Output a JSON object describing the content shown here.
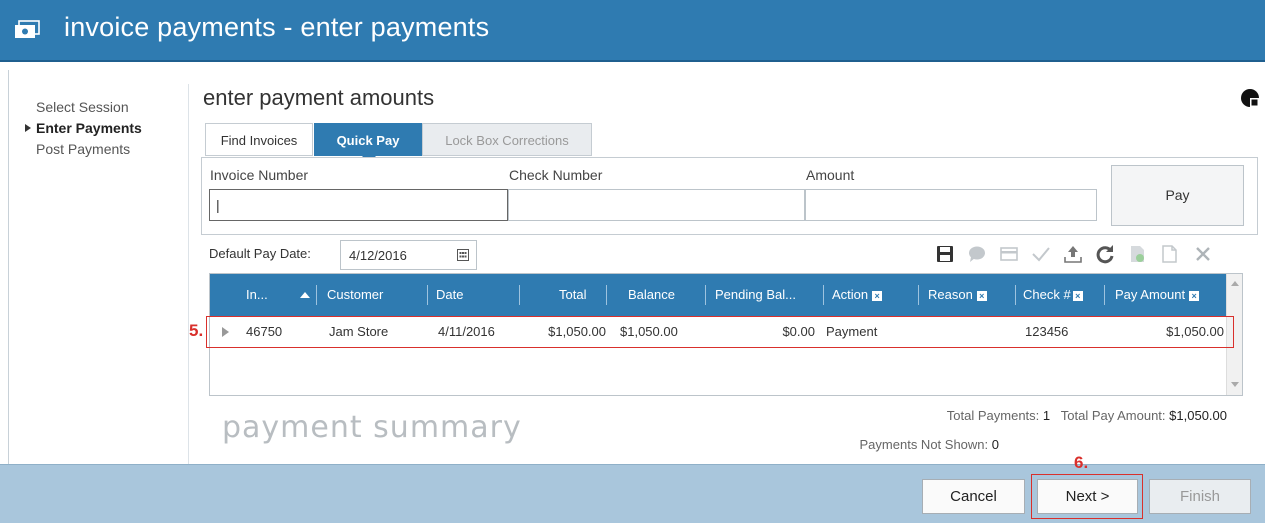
{
  "window": {
    "title": "invoice payments - enter payments"
  },
  "steps": [
    {
      "label": "Select Session",
      "active": false
    },
    {
      "label": "Enter Payments",
      "active": true
    },
    {
      "label": "Post Payments",
      "active": false
    }
  ],
  "section": {
    "title": "enter payment amounts"
  },
  "tabs": [
    {
      "label": "Find Invoices",
      "state": "normal"
    },
    {
      "label": "Quick Pay",
      "state": "selected"
    },
    {
      "label": "Lock Box Corrections",
      "state": "disabled"
    }
  ],
  "quickpay": {
    "invoice_label": "Invoice Number",
    "invoice_value": "|",
    "check_label": "Check Number",
    "check_value": "",
    "amount_label": "Amount",
    "amount_value": "",
    "pay_button": "Pay"
  },
  "paydate": {
    "label": "Default Pay Date:",
    "value": "4/12/2016"
  },
  "toolbar_icons": [
    "save-icon",
    "comment-icon",
    "card-icon",
    "check-icon",
    "upload-icon",
    "refresh-icon",
    "export-icon",
    "copy-icon",
    "delete-icon"
  ],
  "grid": {
    "columns": [
      "In...",
      "Customer",
      "Date",
      "Total",
      "Balance",
      "Pending Bal...",
      "Action",
      "Reason",
      "Check #",
      "Pay Amount"
    ],
    "rows": [
      {
        "invoice": "46750",
        "customer": "Jam Store",
        "date": "4/11/2016",
        "total": "$1,050.00",
        "balance": "$1,050.00",
        "pending": "$0.00",
        "action": "Payment",
        "reason": "",
        "check": "123456",
        "pay_amount": "$1,050.00"
      }
    ]
  },
  "annotations": {
    "row_marker": "5.",
    "next_marker": "6."
  },
  "summary": {
    "title": "payment summary",
    "total_payments_label": "Total Payments:",
    "total_payments_value": "1",
    "total_amount_label": "Total Pay Amount:",
    "total_amount_value": "$1,050.00",
    "not_shown_label": "Payments Not Shown:",
    "not_shown_value": "0"
  },
  "footer": {
    "cancel": "Cancel",
    "next": "Next >",
    "finish": "Finish"
  },
  "colors": {
    "brand": "#2f7bb1",
    "footer": "#a9c6dc",
    "annotation": "#d9302c"
  }
}
